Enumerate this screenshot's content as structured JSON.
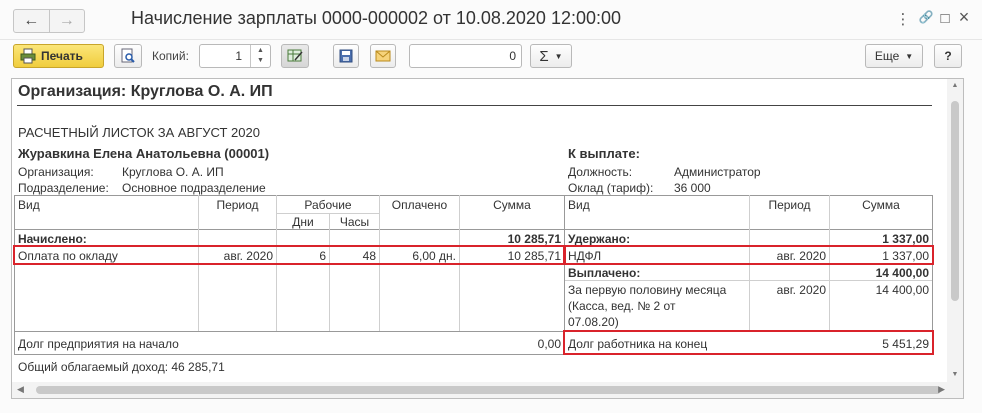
{
  "window": {
    "title": "Начисление зарплаты 0000-000002 от 10.08.2020 12:00:00",
    "controls": {
      "menu": "⋮",
      "link": "🔗",
      "maximize": "□",
      "close": "×"
    }
  },
  "nav": {
    "back": "←",
    "forward": "→"
  },
  "toolbar": {
    "print_label": "Печать",
    "copies_label": "Копий:",
    "copies_value": "1",
    "number_value": "0",
    "sum_label": "Σ",
    "more_label": "Еще",
    "help_label": "?"
  },
  "report": {
    "org_title": "Организация: Круглова О. А. ИП",
    "sheet_title": "РАСЧЕТНЫЙ ЛИСТОК ЗА АВГУСТ 2020",
    "employee": "Журавкина Елена Анатольевна (00001)",
    "org_label": "Организация:",
    "org_value": "Круглова О. А. ИП",
    "dept_label": "Подразделение:",
    "dept_value": "Основное подразделение",
    "to_pay": "К выплате:",
    "position_label": "Должность:",
    "position_value": "Администратор",
    "salary_label": "Оклад (тариф):",
    "salary_value": "36 000",
    "left_headers": {
      "vid": "Вид",
      "period": "Период",
      "working": "Рабочие",
      "days": "Дни",
      "hours": "Часы",
      "paid": "Оплачено",
      "sum": "Сумма"
    },
    "right_headers": {
      "vid": "Вид",
      "period": "Период",
      "sum": "Сумма"
    },
    "accrued_label": "Начислено:",
    "accrued_total": "10 285,71",
    "accrual_row": {
      "vid": "Оплата по окладу",
      "period": "авг. 2020",
      "days": "6",
      "hours": "48",
      "paid": "6,00 дн.",
      "sum": "10 285,71"
    },
    "withheld_label": "Удержано:",
    "withheld_total": "1 337,00",
    "ndfl_row": {
      "vid": "НДФЛ",
      "period": "авг. 2020",
      "sum": "1 337,00"
    },
    "paid_label": "Выплачено:",
    "paid_total": "14 400,00",
    "payment_row": {
      "line1": "За первую половину месяца",
      "line2": "(Касса, вед. № 2 от",
      "line3": "07.08.20)",
      "period": "авг. 2020",
      "sum": "14 400,00"
    },
    "debt_company_label": "Долг предприятия на начало",
    "debt_company_value": "0,00",
    "debt_employee_label": "Долг работника на конец",
    "debt_employee_value": "5 451,29",
    "taxable_income": "Общий облагаемый доход: 46 285,71"
  },
  "colors": {
    "highlight": "#d9232b",
    "print_button": "#f0cd3d"
  }
}
